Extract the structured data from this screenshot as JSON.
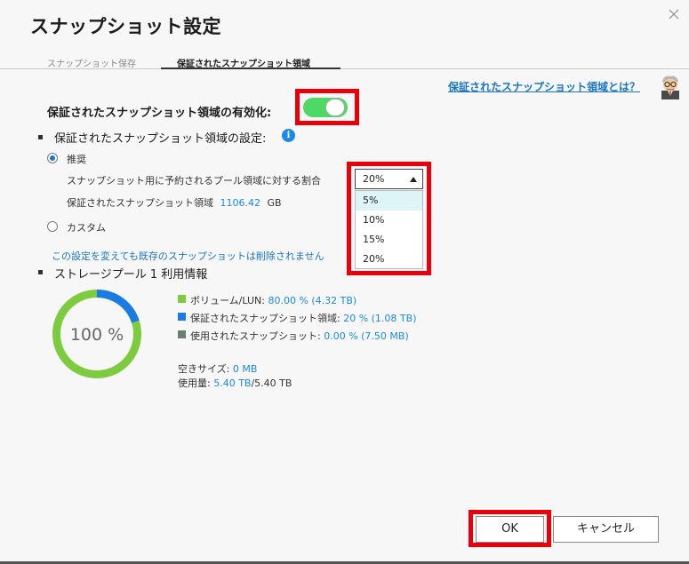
{
  "dialog": {
    "title": "スナップショット設定"
  },
  "tabs": [
    {
      "label": "スナップショット保存",
      "active": false
    },
    {
      "label": "保証されたスナップショット領域",
      "active": true
    }
  ],
  "help": {
    "link": "保証されたスナップショット領域とは？"
  },
  "enable": {
    "label": "保証されたスナップショット領域の有効化:",
    "toggle_on": true,
    "toggle_color": "#4cd964"
  },
  "settings": {
    "label": "保証されたスナップショット領域の設定:",
    "info_icon": "i",
    "recommended_label": "推奨",
    "ratio_label": "スナップショット用に予約されるプール領域に対する割合",
    "reserved_label": "保証されたスナップショット領域",
    "reserved_value": "1106.42",
    "reserved_unit": "GB",
    "custom_label": "カスタム",
    "note": "この設定を変えても既存のスナップショットは削除されません"
  },
  "ratio_select": {
    "value": "20%",
    "options": [
      "5%",
      "10%",
      "15%",
      "20%"
    ],
    "highlighted": "5%"
  },
  "pool": {
    "label": "ストレージプール 1 利用情報",
    "donut_text": "100 %",
    "fractions": {
      "volume": 0.8,
      "snapshot_reserved": 0.2,
      "snapshot_used": 0.0
    },
    "legend": [
      {
        "label": "ボリューム/LUN: ",
        "value": "80.00 % (4.32 TB)",
        "color": "#7dcb3f"
      },
      {
        "label": "保証されたスナップショット領域: ",
        "value": "20 % (1.08 TB)",
        "color": "#1a7be4"
      },
      {
        "label": "使用されたスナップショット: ",
        "value": "0.00 % (7.50 MB)",
        "color": "#6d7f72"
      }
    ],
    "free_label": "空きサイズ: ",
    "free_value": "0 MB",
    "used_label": "使用量: ",
    "used_value": "5.40 TB",
    "used_total": "/5.40 TB"
  },
  "buttons": {
    "ok": "OK",
    "cancel": "キャンセル"
  },
  "colors": {
    "highlight": "#e8000b",
    "accent_blue": "#1a75c2"
  }
}
